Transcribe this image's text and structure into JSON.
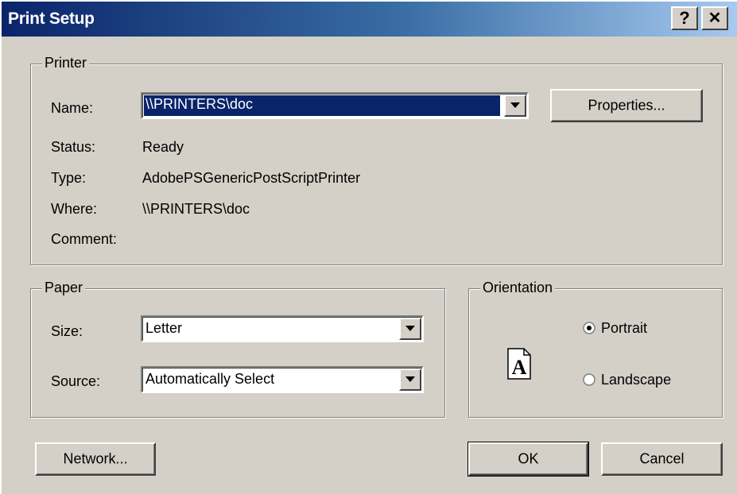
{
  "window": {
    "title": "Print Setup",
    "help_label": "?",
    "close_label": "✕"
  },
  "printer": {
    "group_label": "Printer",
    "name_label": "Name:",
    "name_value": "\\\\PRINTERS\\doc",
    "properties_label": "Properties...",
    "status_label": "Status:",
    "status_value": "Ready",
    "type_label": "Type:",
    "type_value": "AdobePSGenericPostScriptPrinter",
    "where_label": "Where:",
    "where_value": "\\\\PRINTERS\\doc",
    "comment_label": "Comment:"
  },
  "paper": {
    "group_label": "Paper",
    "size_label": "Size:",
    "size_value": "Letter",
    "source_label": "Source:",
    "source_value": "Automatically Select"
  },
  "orientation": {
    "group_label": "Orientation",
    "portrait_label": "Portrait",
    "landscape_label": "Landscape",
    "selected": "portrait",
    "preview_glyph": "A"
  },
  "buttons": {
    "network_label": "Network...",
    "ok_label": "OK",
    "cancel_label": "Cancel"
  },
  "icons": {
    "dropdown": "chevron-down-icon",
    "help": "help-icon",
    "close": "close-icon",
    "page_preview": "portrait-page-icon"
  }
}
